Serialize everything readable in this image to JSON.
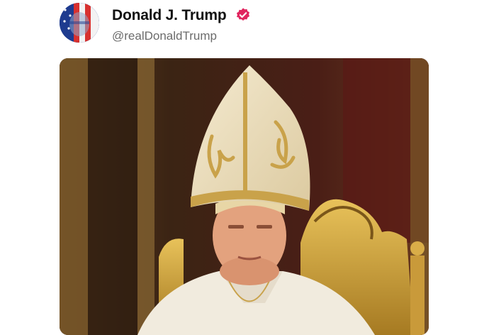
{
  "post": {
    "author_name": "Donald J. Trump",
    "author_handle": "@realDonaldTrump",
    "verified": true,
    "verified_badge_color": "#e0245e",
    "avatar_icon": "flag-portrait-avatar",
    "image_subject": "man-in-papal-vestments-image"
  },
  "colors": {
    "background": "#ffffff",
    "name_text": "#111111",
    "handle_text": "#6b6b6b"
  }
}
